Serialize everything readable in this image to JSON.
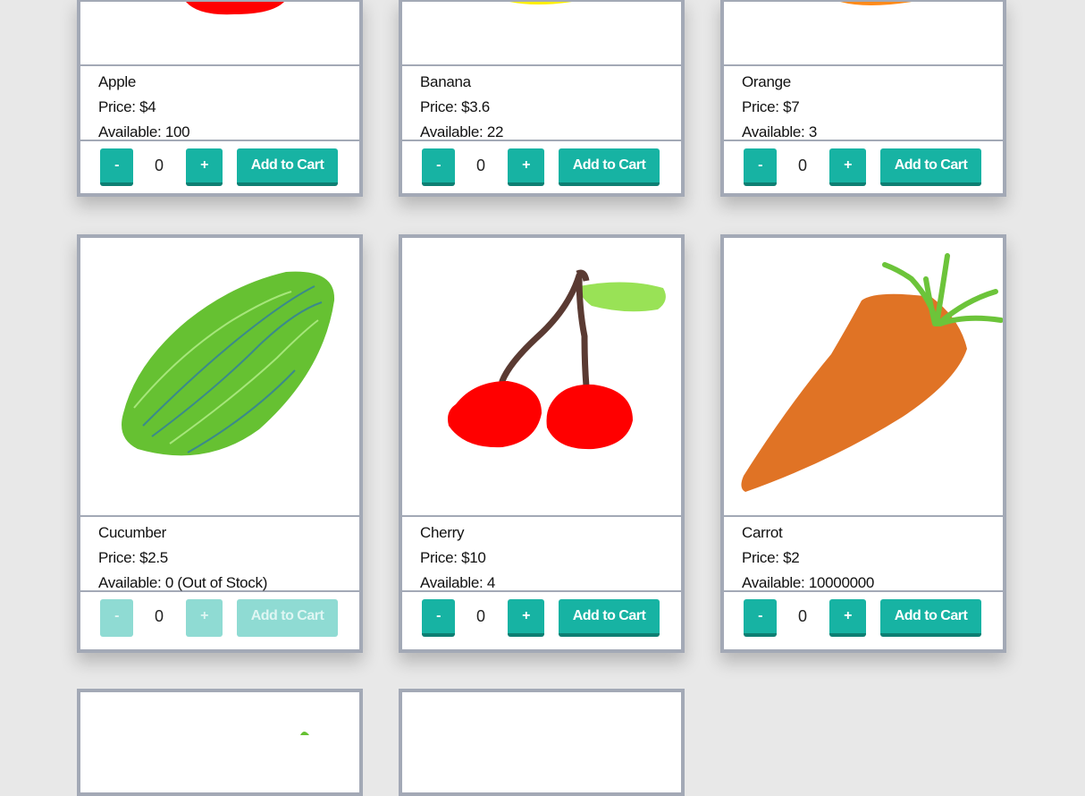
{
  "products": [
    {
      "name": "Apple",
      "price": "Price: $4",
      "available": "Available: 100",
      "qty": "0",
      "minus": "-",
      "plus": "+",
      "add": "Add to Cart"
    },
    {
      "name": "Banana",
      "price": "Price: $3.6",
      "available": "Available: 22",
      "qty": "0",
      "minus": "-",
      "plus": "+",
      "add": "Add to Cart"
    },
    {
      "name": "Orange",
      "price": "Price: $7",
      "available": "Available: 3",
      "qty": "0",
      "minus": "-",
      "plus": "+",
      "add": "Add to Cart"
    },
    {
      "name": "Cucumber",
      "price": "Price: $2.5",
      "available": "Available: 0 (Out of Stock)",
      "qty": "0",
      "minus": "-",
      "plus": "+",
      "add": "Add to Cart",
      "disabled": true
    },
    {
      "name": "Cherry",
      "price": "Price: $10",
      "available": "Available: 4",
      "qty": "0",
      "minus": "-",
      "plus": "+",
      "add": "Add to Cart"
    },
    {
      "name": "Carrot",
      "price": "Price: $2",
      "available": "Available: 10000000",
      "qty": "0",
      "minus": "-",
      "plus": "+",
      "add": "Add to Cart"
    }
  ],
  "icons": [
    "apple-drawing",
    "banana-drawing",
    "orange-drawing",
    "cucumber-drawing",
    "cherry-drawing",
    "carrot-drawing",
    "pear-drawing",
    "blank-drawing"
  ],
  "colors": {
    "accent": "#17b3a3",
    "accent_dark": "#0e7f73",
    "accent_disabled": "#8fdbd3",
    "card_border": "#a3a9b6",
    "background": "#e8e8e8"
  }
}
